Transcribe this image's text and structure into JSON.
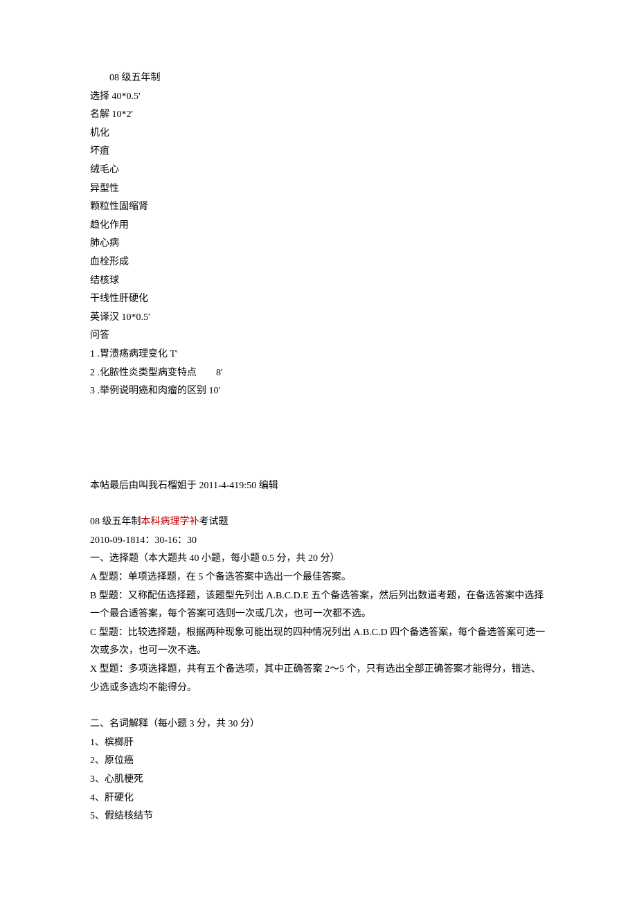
{
  "section1": {
    "title": "08 级五年制",
    "choice_line": "选择 40*0.5'",
    "terms_line": "名解 10*2'",
    "terms": [
      "机化",
      "坏疽",
      "绒毛心",
      "异型性",
      "颗粒性固缩肾",
      "趋化作用",
      "肺心病",
      "血栓形成",
      "结核球",
      "干线性肝硬化"
    ],
    "trans_line": "英译汉 10*0.5'",
    "qa_label": "问答",
    "qa_items": [
      {
        "num": "1",
        "text": ".胃溃疡病理变化 T'"
      },
      {
        "num": "2",
        "text": ".化脓性炎类型病变特点",
        "suffix": "8'"
      },
      {
        "num": "3",
        "text": ".举例说明癌和肉瘤的区别 10'"
      }
    ]
  },
  "section2": {
    "edit_note": "本帖最后由叫我石榴姐于 2011-4-419:50 编辑",
    "title_prefix": "08 级五年制",
    "title_red": "本科病理学补",
    "title_suffix": "考试题",
    "timestamp": "2010-09-1814：30-16：30",
    "part1_title": "一、选择题（本大题共 40 小题，每小题 0.5 分，共 20 分）",
    "type_a": "A 型题：单项选择题，在 5 个备选答案中选出一个最佳答案。",
    "type_b": "B 型题：又称配伍选择题，该题型先列出 A.B.C.D.E 五个备选答案，然后列出数道考题，在备选答案中选择一个最合适答案，每个答案可选则一次或几次，也可一次都不选。",
    "type_c": "C 型题：比较选择题，根据两种现象可能出现的四种情况列出 A.B.C.D 四个备选答案，每个备选答案可选一次或多次，也可一次不选。",
    "type_x": "X 型题：多项选择题，共有五个备选项，其中正确答案 2～5 个，只有选出全部正确答案才能得分，错选、少选或多选均不能得分。",
    "part2_title": "二、名词解释（每小题 3 分，共 30 分）",
    "definitions": [
      "1、槟榔肝",
      "2、原位癌",
      "3、心肌梗死",
      "4、肝硬化",
      "5、假结核结节"
    ]
  }
}
